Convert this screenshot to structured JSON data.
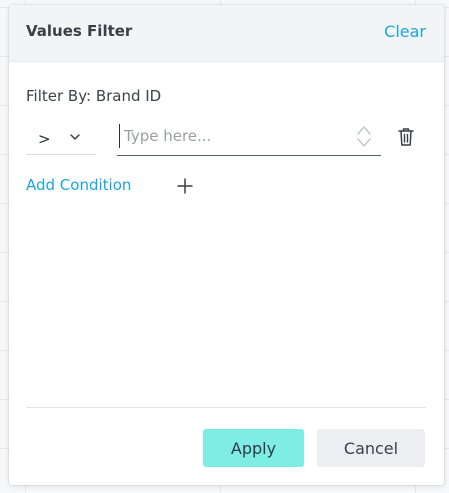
{
  "header": {
    "title": "Values Filter",
    "clear_label": "Clear"
  },
  "filter": {
    "filter_by_text": "Filter By: Brand ID",
    "condition": {
      "operator": ">",
      "value": "",
      "placeholder": "Type here..."
    },
    "add_condition_label": "Add Condition"
  },
  "footer": {
    "apply_label": "Apply",
    "cancel_label": "Cancel"
  },
  "icons": {
    "operator_dropdown": "chevron-down-icon",
    "stepper_up": "chevron-up-icon",
    "stepper_down": "chevron-down-icon",
    "delete": "trash-icon",
    "add": "plus-icon"
  },
  "colors": {
    "accent": "#1aa6e0",
    "apply_button": "#7eeee5",
    "cancel_button": "#eceef2",
    "header_bg": "#f3f4f6"
  }
}
